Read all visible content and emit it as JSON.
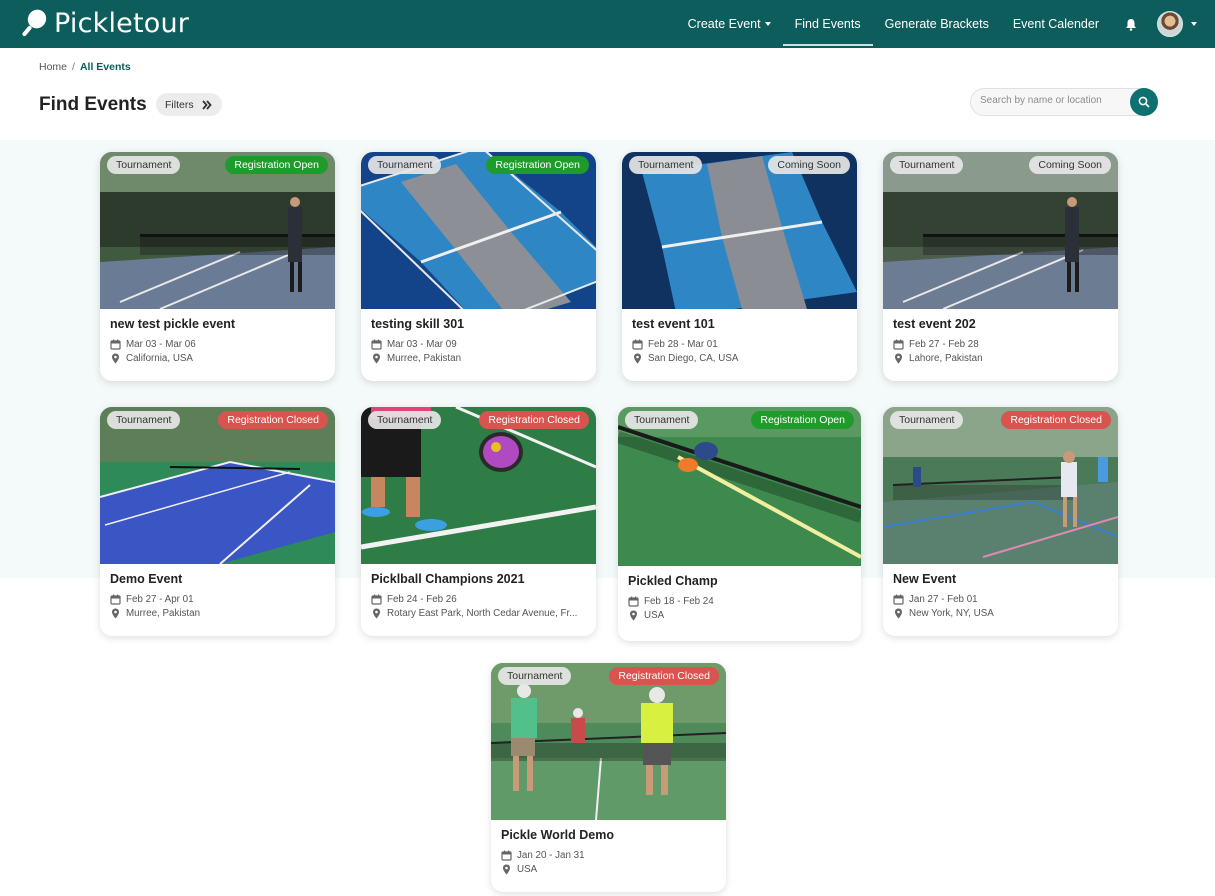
{
  "brand": {
    "name": "Pickletour"
  },
  "nav": {
    "create_event": "Create Event",
    "find_events": "Find Events",
    "generate_brackets": "Generate Brackets",
    "event_calender": "Event Calender"
  },
  "breadcrumb": {
    "home": "Home",
    "separator": "/",
    "current": "All Events"
  },
  "page": {
    "title": "Find Events",
    "filters_label": "Filters"
  },
  "search": {
    "placeholder": "Search by name or location"
  },
  "colors": {
    "primary": "#0e5d5d",
    "open": "#1f9b2b",
    "closed": "#d9534f"
  },
  "events": [
    {
      "type": "Tournament",
      "status": "Registration Open",
      "title": "new test pickle event",
      "dates": "Mar 03 - Mar 06",
      "location": "California, USA"
    },
    {
      "type": "Tournament",
      "status": "Registration Open",
      "title": "testing skill 301",
      "dates": "Mar 03 - Mar 09",
      "location": "Murree, Pakistan"
    },
    {
      "type": "Tournament",
      "status": "Coming Soon",
      "title": "test event 101",
      "dates": "Feb 28 - Mar 01",
      "location": "San Diego, CA, USA"
    },
    {
      "type": "Tournament",
      "status": "Coming Soon",
      "title": "test event 202",
      "dates": "Feb 27 - Feb 28",
      "location": "Lahore, Pakistan"
    },
    {
      "type": "Tournament",
      "status": "Registration Closed",
      "title": "Demo Event",
      "dates": "Feb 27 - Apr 01",
      "location": "Murree, Pakistan"
    },
    {
      "type": "Tournament",
      "status": "Registration Closed",
      "title": "Picklball Champions 2021",
      "dates": "Feb 24 - Feb 26",
      "location": "Rotary East Park, North Cedar Avenue, Fr..."
    },
    {
      "type": "Tournament",
      "status": "Registration Open",
      "title": "Pickled Champ",
      "dates": "Feb 18 - Feb 24",
      "location": "USA"
    },
    {
      "type": "Tournament",
      "status": "Registration Closed",
      "title": "New Event",
      "dates": "Jan 27 - Feb 01",
      "location": "New York, NY, USA"
    },
    {
      "type": "Tournament",
      "status": "Registration Closed",
      "title": "Pickle World Demo",
      "dates": "Jan 20 - Jan 31",
      "location": "USA"
    }
  ]
}
